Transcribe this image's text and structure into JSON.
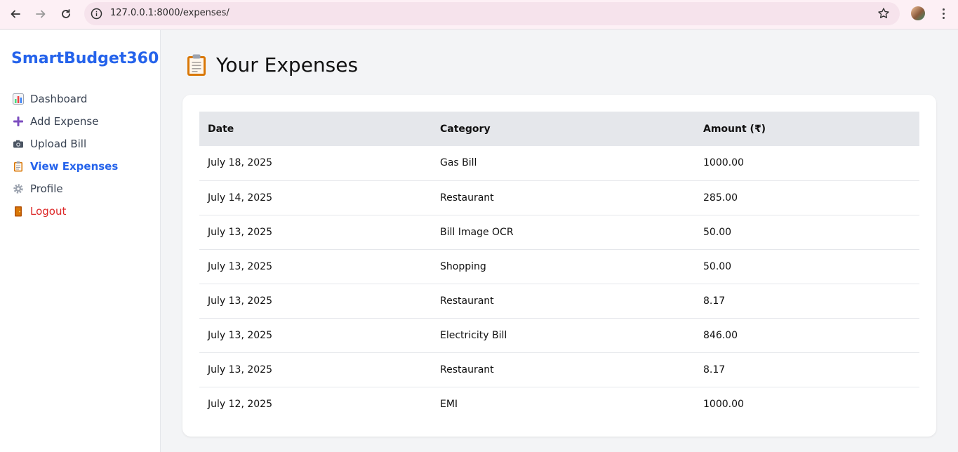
{
  "browser": {
    "url": "127.0.0.1:8000/expenses/"
  },
  "sidebar": {
    "brand": "SmartBudget360",
    "items": [
      {
        "label": "Dashboard",
        "icon": "bar-chart-icon"
      },
      {
        "label": "Add Expense",
        "icon": "plus-icon"
      },
      {
        "label": "Upload Bill",
        "icon": "camera-icon"
      },
      {
        "label": "View Expenses",
        "icon": "clipboard-icon",
        "active": true
      },
      {
        "label": "Profile",
        "icon": "gear-icon"
      },
      {
        "label": "Logout",
        "icon": "door-icon"
      }
    ]
  },
  "page": {
    "title": "Your Expenses",
    "title_icon": "clipboard-icon"
  },
  "table": {
    "headers": [
      "Date",
      "Category",
      "Amount (₹)"
    ],
    "rows": [
      [
        "July 18, 2025",
        "Gas Bill",
        "1000.00"
      ],
      [
        "July 14, 2025",
        "Restaurant",
        "285.00"
      ],
      [
        "July 13, 2025",
        "Bill Image OCR",
        "50.00"
      ],
      [
        "July 13, 2025",
        "Shopping",
        "50.00"
      ],
      [
        "July 13, 2025",
        "Restaurant",
        "8.17"
      ],
      [
        "July 13, 2025",
        "Electricity Bill",
        "846.00"
      ],
      [
        "July 13, 2025",
        "Restaurant",
        "8.17"
      ],
      [
        "July 12, 2025",
        "EMI",
        "1000.00"
      ]
    ]
  },
  "colors": {
    "brand": "#2563eb",
    "logout": "#dc2626",
    "header_bg": "#e5e7eb"
  }
}
